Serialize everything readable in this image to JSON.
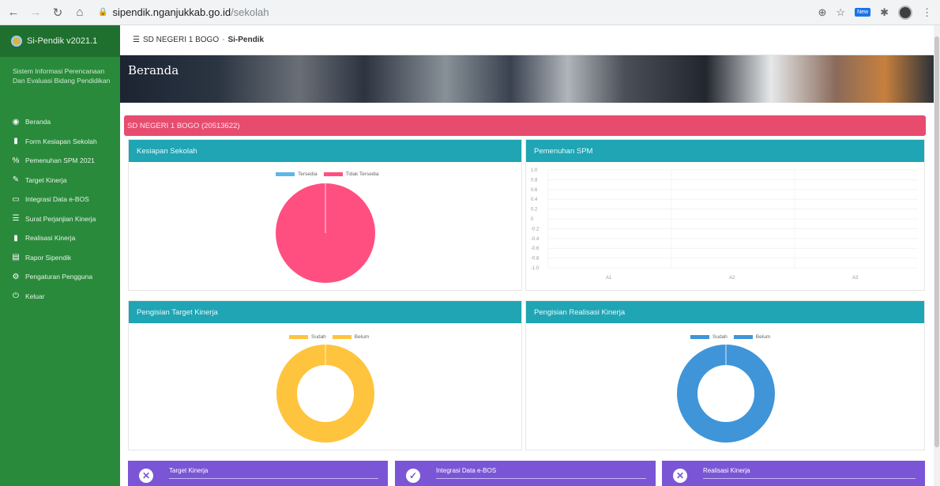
{
  "browser": {
    "url_host": "sipendik.nganjukkab.go.id",
    "url_path": "/sekolah",
    "ext_badge": "New"
  },
  "sidebar": {
    "brand": "Si-Pendik v2021.1",
    "tagline": "Sistem Informasi Perencanaan Dan Evaluasi Bidang Pendidikan",
    "items": [
      {
        "label": "Beranda",
        "icon": "dashboard-icon"
      },
      {
        "label": "Form Kesiapan Sekolah",
        "icon": "document-icon"
      },
      {
        "label": "Pemenuhan SPM 2021",
        "icon": "percent-icon"
      },
      {
        "label": "Target Kinerja",
        "icon": "edit-icon"
      },
      {
        "label": "Integrasi Data e-BOS",
        "icon": "monitor-icon"
      },
      {
        "label": "Surat Perjanjian Kinerja",
        "icon": "list-icon"
      },
      {
        "label": "Realisasi Kinerja",
        "icon": "file-icon"
      },
      {
        "label": "Rapor Sipendik",
        "icon": "report-icon"
      },
      {
        "label": "Pengaturan Pengguna",
        "icon": "gears-icon"
      },
      {
        "label": "Keluar",
        "icon": "power-icon"
      }
    ]
  },
  "topbar": {
    "menu_icon": "hamburger-icon",
    "school": "SD NEGERI 1 BOGO",
    "separator": "-",
    "app": "Si-Pendik"
  },
  "banner": {
    "title": "Beranda"
  },
  "school_bar": {
    "label": "SD NEGERI 1 BOGO (20513622)"
  },
  "cards": {
    "kesiapan": {
      "title": "Kesiapan Sekolah",
      "legend": [
        "Tersedia",
        "Tidak Tersedia"
      ]
    },
    "spm": {
      "title": "Pemenuhan SPM"
    },
    "target": {
      "title": "Pengisian Target Kinerja",
      "legend": [
        "Sudah",
        "Belum"
      ]
    },
    "realisasi": {
      "title": "Pengisian Realisasi Kinerja",
      "legend": [
        "Sudah",
        "Belum"
      ]
    }
  },
  "stats": [
    {
      "title": "Target Kinerja",
      "icon": "times-circle-icon",
      "glyph": "✕"
    },
    {
      "title": "Integrasi Data e-BOS",
      "icon": "check-circle-icon",
      "glyph": "✓"
    },
    {
      "title": "Realisasi Kinerja",
      "icon": "times-circle-icon",
      "glyph": "✕"
    }
  ],
  "colors": {
    "sidebar": "#2a8a3b",
    "header_teal": "#1fa5b4",
    "school_bar": "#e74c6f",
    "pink": "#ff4f81",
    "blue_light": "#5db7e8",
    "yellow": "#ffc43d",
    "blue": "#3f95d8",
    "purple": "#7a56d6"
  },
  "chart_data": [
    {
      "type": "pie",
      "title": "Kesiapan Sekolah",
      "labels": [
        "Tersedia",
        "Tidak Tersedia"
      ],
      "values": [
        0,
        100
      ],
      "colors": [
        "#5db7e8",
        "#ff4f81"
      ]
    },
    {
      "type": "bar",
      "title": "Pemenuhan SPM",
      "categories": [
        "A1",
        "A2",
        "A3"
      ],
      "values": [
        0,
        0,
        0
      ],
      "ylim": [
        -1,
        1
      ],
      "yticks": [
        "1.0",
        "0.8",
        "0.6",
        "0.4",
        "0.2",
        "0",
        "-0.2",
        "-0.4",
        "-0.6",
        "-0.8",
        "-1.0"
      ],
      "grid": true
    },
    {
      "type": "pie",
      "title": "Pengisian Target Kinerja",
      "labels": [
        "Sudah",
        "Belum"
      ],
      "values": [
        0,
        100
      ],
      "colors": [
        "#ffc43d",
        "#ffc43d"
      ],
      "donut": true
    },
    {
      "type": "pie",
      "title": "Pengisian Realisasi Kinerja",
      "labels": [
        "Sudah",
        "Belum"
      ],
      "values": [
        0,
        100
      ],
      "colors": [
        "#3f95d8",
        "#3f95d8"
      ],
      "donut": true
    }
  ]
}
